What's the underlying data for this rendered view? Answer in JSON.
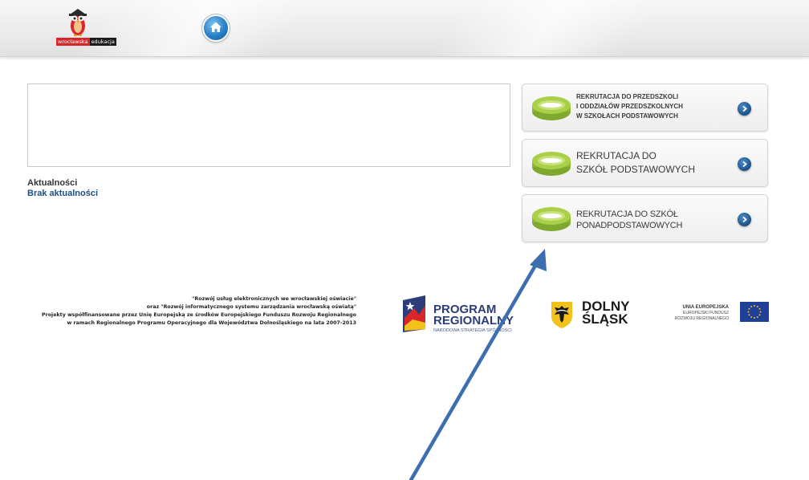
{
  "header": {
    "logo": {
      "brand_part1": "wrocławska",
      "brand_part2": "edukacja",
      "icon": "owl-mascot-icon"
    },
    "home_button": {
      "icon": "home-icon"
    }
  },
  "news": {
    "label": "Aktualności",
    "empty_text": "Brak aktualności"
  },
  "recruitment": {
    "items": [
      {
        "lines": [
          "REKRUTACJA DO PRZEDSZKOLI",
          "I ODDZIAŁÓW PRZEDSZKOLNYCH",
          "W SZKOŁACH PODSTAWOWYCH"
        ],
        "icon": "disc-icon"
      },
      {
        "lines": [
          "REKRUTACJA DO",
          "SZKÓŁ PODSTAWOWYCH"
        ],
        "icon": "disc-icon"
      },
      {
        "lines": [
          "REKRUTACJA DO SZKÓŁ",
          "PONADPODSTAWOWYCH"
        ],
        "icon": "disc-icon"
      }
    ],
    "arrow_icon": "chevron-right-icon"
  },
  "footer": {
    "lines": [
      "\"Rozwój usług elektronicznych we wrocławskiej oświacie\"",
      "oraz \"Rozwój informatycznego systemu zarządzania wrocławską oświatą\"",
      "Projekty współfinansowane przez Unię Europejską ze środków Europejskiego Funduszu Rozwoju Regionalnego",
      "w ramach Regionalnego Programu Operacyjnego dla Województwa Dolnośląskiego na lata 2007-2013"
    ],
    "program_regionalny": {
      "line1": "PROGRAM",
      "line2": "REGIONALNY",
      "line3": "NARODOWA STRATEGIA SPÓJNOŚCI"
    },
    "dolny_slask": {
      "line1": "DOLNY",
      "line2": "ŚLĄSK"
    },
    "unia": {
      "line1": "UNIA EUROPEJSKA",
      "line2": "EUROPEJSKI FUNDUSZ",
      "line3": "ROZWOJU REGIONALNEGO"
    }
  },
  "colors": {
    "link_blue": "#1a4f86",
    "disc_green": "#9bc53d",
    "eu_blue": "#1f3f99",
    "annotation_arrow": "#3d6fb0"
  }
}
